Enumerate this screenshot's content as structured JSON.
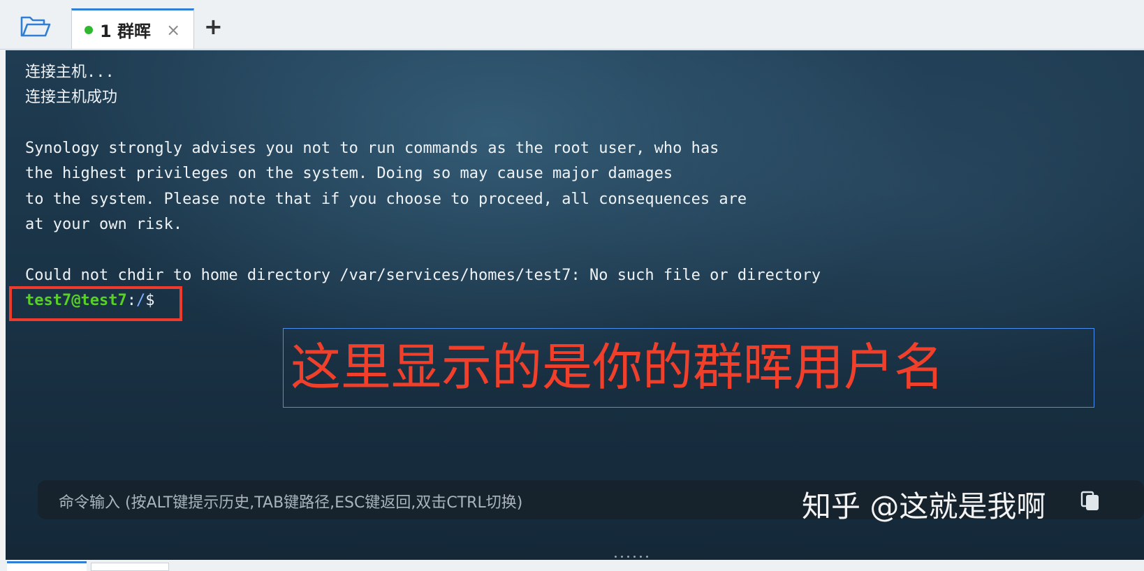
{
  "tabbar": {
    "folder_icon": "folder-open-icon",
    "tab_label": "1 群晖",
    "tab_close": "×",
    "add_tab": "+",
    "status_color": "#2eb82e"
  },
  "terminal": {
    "lines": [
      "连接主机...",
      "连接主机成功",
      "",
      "Synology strongly advises you not to run commands as the root user, who has",
      "the highest privileges on the system. Doing so may cause major damages",
      "to the system. Please note that if you choose to proceed, all consequences are",
      "at your own risk.",
      "",
      "Could not chdir to home directory /var/services/homes/test7: No such file or directory"
    ],
    "prompt": {
      "user_host": "test7@test7",
      "sep": ":",
      "path": "/",
      "symbol": "$"
    }
  },
  "annotation": {
    "text": "这里显示的是你的群晖用户名",
    "color": "#f0402b"
  },
  "command_input": {
    "placeholder": "命令输入 (按ALT键提示历史,TAB键路径,ESC键返回,双击CTRL切换)"
  },
  "watermark": {
    "text": "知乎 @这就是我啊"
  }
}
